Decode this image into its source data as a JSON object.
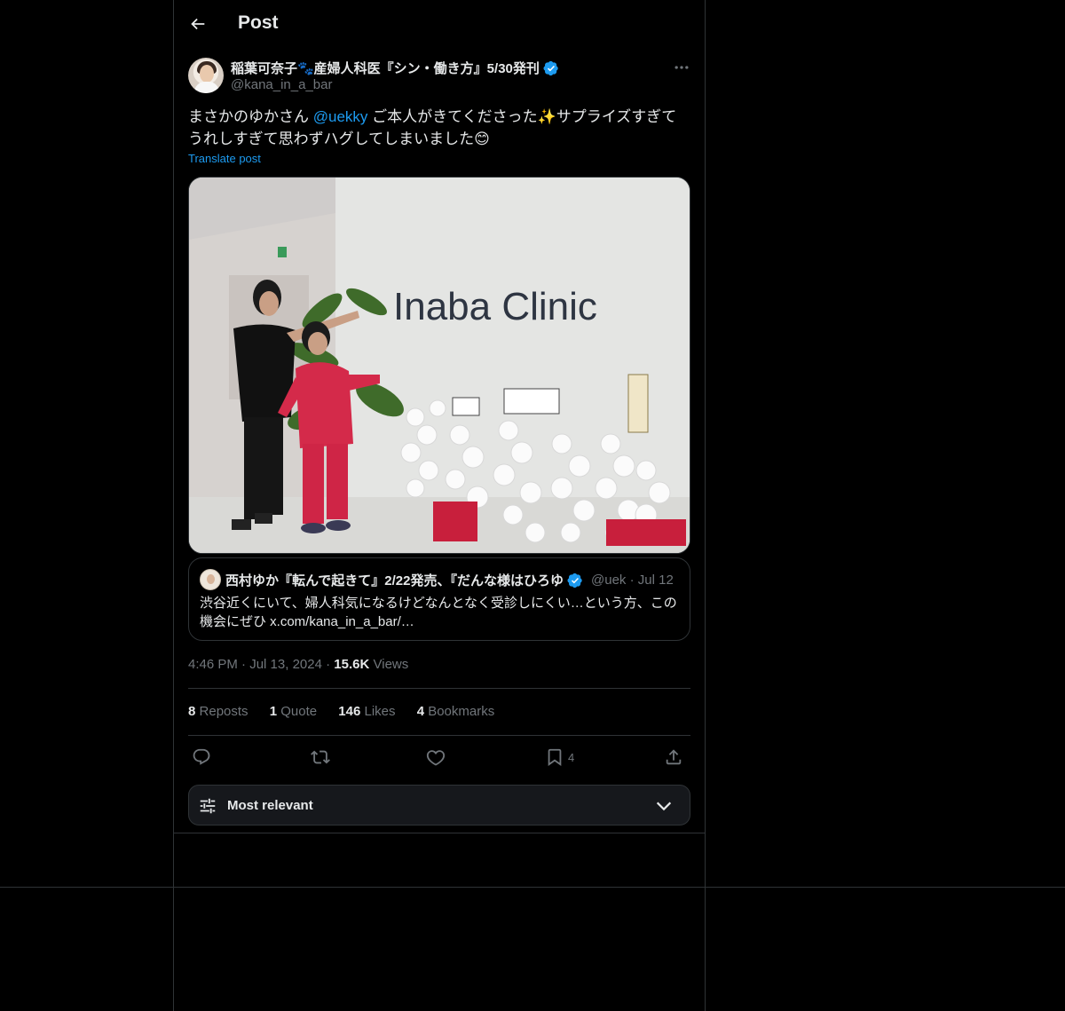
{
  "header": {
    "title": "Post"
  },
  "author": {
    "name": "稲葉可奈子🐾産婦人科医『シン・働き方』5/30発刊",
    "handle": "@kana_in_a_bar"
  },
  "tweet": {
    "text_before": "まさかのゆかさん ",
    "mention": "@uekky",
    "text_after": " ご本人がきてくださった✨サプライズすぎてうれしすぎて思わずハグしてしまいました😊",
    "translate_label": "Translate post"
  },
  "photo": {
    "wall_sign": "Inaba Clinic"
  },
  "quote": {
    "name": "西村ゆか『転んで起きて』2/22発売、『だんな様はひろゆ",
    "handle": "@uek",
    "date": "Jul 12",
    "text": "渋谷近くにいて、婦人科気になるけどなんとなく受診しにくい…という方、この機会にぜひ x.com/kana_in_a_bar/…"
  },
  "meta": {
    "time": "4:46 PM",
    "date": "Jul 13, 2024",
    "views_count": "15.6K",
    "views_label": "Views"
  },
  "stats": {
    "reposts_count": "8",
    "reposts_label": "Reposts",
    "quotes_count": "1",
    "quotes_label": "Quote",
    "likes_count": "146",
    "likes_label": "Likes",
    "bookmarks_count": "4",
    "bookmarks_label": "Bookmarks"
  },
  "actions": {
    "bookmark_count": "4"
  },
  "sort": {
    "label": "Most relevant"
  },
  "colors": {
    "accent": "#1d9bf0",
    "background": "#000000",
    "border": "#2f3336",
    "muted": "#71767b"
  }
}
